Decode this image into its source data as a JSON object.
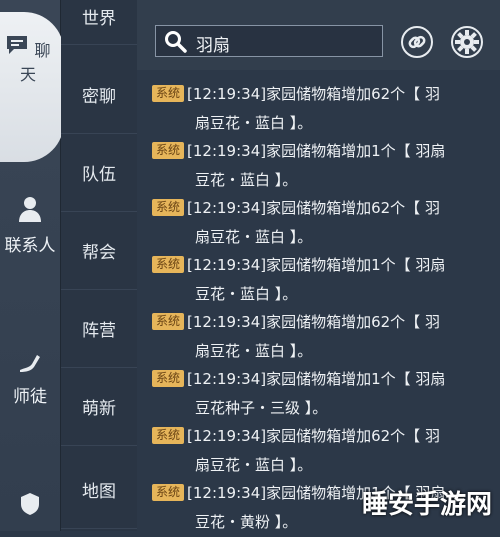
{
  "rail": {
    "items": [
      {
        "label": "聊天",
        "icon": "chat-icon",
        "active": true
      },
      {
        "label": "联系人",
        "icon": "contact-icon",
        "active": false
      },
      {
        "label": "师徒",
        "icon": "mentor-icon",
        "active": false
      },
      {
        "label": "",
        "icon": "shield-icon",
        "active": false
      }
    ]
  },
  "channels": [
    "世界",
    "密聊",
    "队伍",
    "帮会",
    "阵营",
    "萌新",
    "地图"
  ],
  "search": {
    "value": "羽扇"
  },
  "messages": [
    {
      "tag": "系统",
      "line1": "[12:19:34]家园储物箱增加62个【 羽",
      "line2": "扇豆花・蓝白 】。"
    },
    {
      "tag": "系统",
      "line1": "[12:19:34]家园储物箱增加1个【 羽扇",
      "line2": "豆花・蓝白 】。"
    },
    {
      "tag": "系统",
      "line1": "[12:19:34]家园储物箱增加62个【 羽",
      "line2": "扇豆花・蓝白 】。"
    },
    {
      "tag": "系统",
      "line1": "[12:19:34]家园储物箱增加1个【 羽扇",
      "line2": "豆花・蓝白 】。"
    },
    {
      "tag": "系统",
      "line1": "[12:19:34]家园储物箱增加62个【 羽",
      "line2": "扇豆花・蓝白 】。"
    },
    {
      "tag": "系统",
      "line1": "[12:19:34]家园储物箱增加1个【 羽扇",
      "line2": "豆花种子・三级 】。"
    },
    {
      "tag": "系统",
      "line1": "[12:19:34]家园储物箱增加62个【 羽",
      "line2": "扇豆花・蓝白 】。"
    },
    {
      "tag": "系统",
      "line1": "[12:19:34]家园储物箱增加1个【 羽扇",
      "line2": "豆花・黄粉 】。"
    }
  ],
  "watermark": "睡安手游网"
}
